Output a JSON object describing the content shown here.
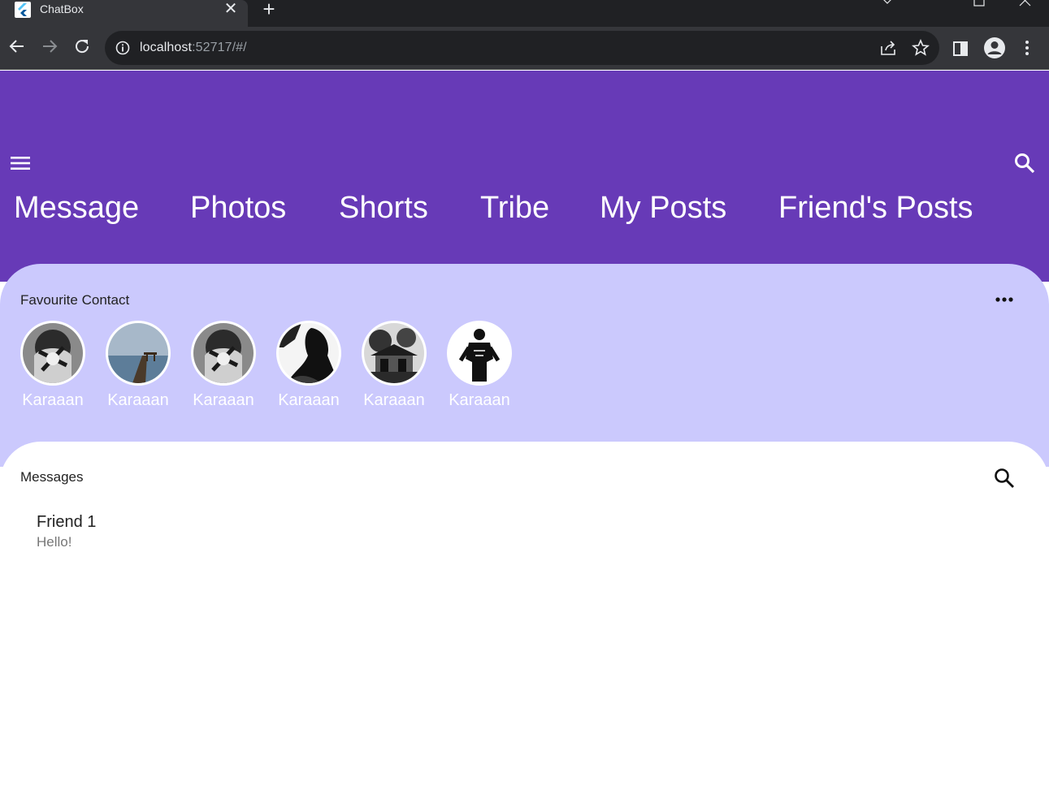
{
  "browser": {
    "tab_title": "ChatBox",
    "url_host": "localhost",
    "url_rest": ":52717/#/",
    "icons": [
      "flutter-favicon",
      "close-icon",
      "plus-icon",
      "back-arrow-icon",
      "forward-arrow-icon",
      "reload-icon",
      "info-icon",
      "share-icon",
      "star-icon",
      "side-panel-icon",
      "profile-icon",
      "kebab-menu-icon"
    ]
  },
  "appbar": {
    "background": "#673ab7",
    "tabs": [
      {
        "label": "Message"
      },
      {
        "label": "Photos"
      },
      {
        "label": "Shorts"
      },
      {
        "label": "Tribe"
      },
      {
        "label": "My Posts"
      },
      {
        "label": "Friend's Posts"
      }
    ]
  },
  "favourites": {
    "title": "Favourite Contact",
    "background": "#cbc9fd",
    "contacts": [
      {
        "name": "Karaaan"
      },
      {
        "name": "Karaaan"
      },
      {
        "name": "Karaaan"
      },
      {
        "name": "Karaaan"
      },
      {
        "name": "Karaaan"
      },
      {
        "name": "Karaaan"
      }
    ]
  },
  "messages": {
    "title": "Messages",
    "items": [
      {
        "name": "Friend 1",
        "preview": "Hello!"
      }
    ]
  }
}
